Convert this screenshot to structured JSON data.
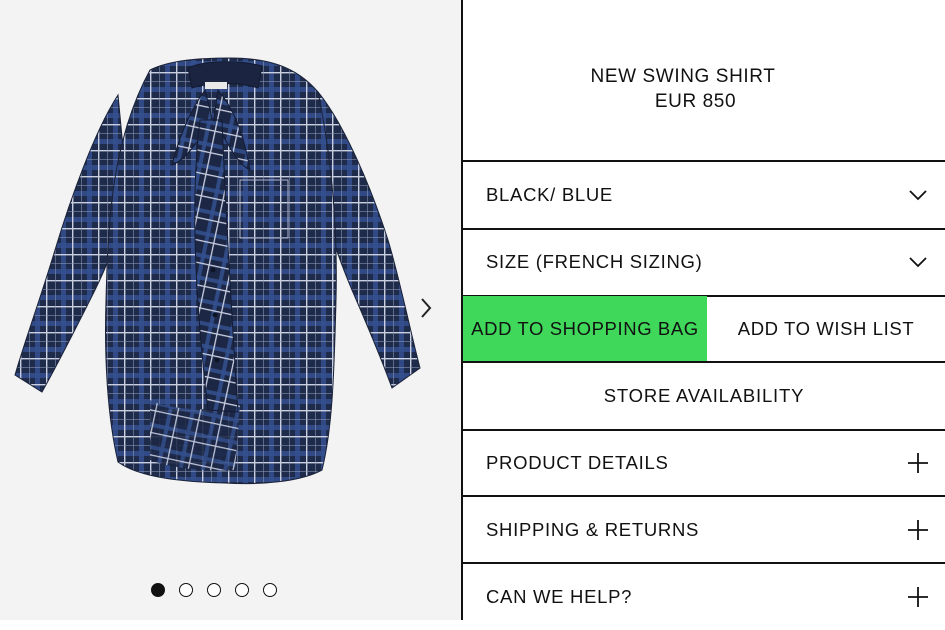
{
  "product": {
    "title": "NEW SWING SHIRT",
    "price": "EUR 850",
    "image_alt": "Navy and blue check shirt with neck tie",
    "colors": {
      "shirt_base": "#1f2b4a",
      "shirt_grid_light": "#c9cfe0",
      "shirt_grid_blue": "#3a5aa8",
      "gallery_bg": "#f3f3f3",
      "accent": "#3fd85a"
    }
  },
  "gallery": {
    "dot_count": 5,
    "active_index": 0,
    "next_icon": "chevron-right-icon"
  },
  "selectors": {
    "color": "BLACK/ BLUE",
    "size": "SIZE (FRENCH SIZING)"
  },
  "actions": {
    "add_to_bag": "ADD TO SHOPPING BAG",
    "add_to_wishlist": "ADD TO WISH LIST",
    "store_availability": "STORE AVAILABILITY"
  },
  "accordions": [
    {
      "label": "PRODUCT DETAILS"
    },
    {
      "label": "SHIPPING & RETURNS"
    },
    {
      "label": "CAN WE HELP?"
    }
  ]
}
